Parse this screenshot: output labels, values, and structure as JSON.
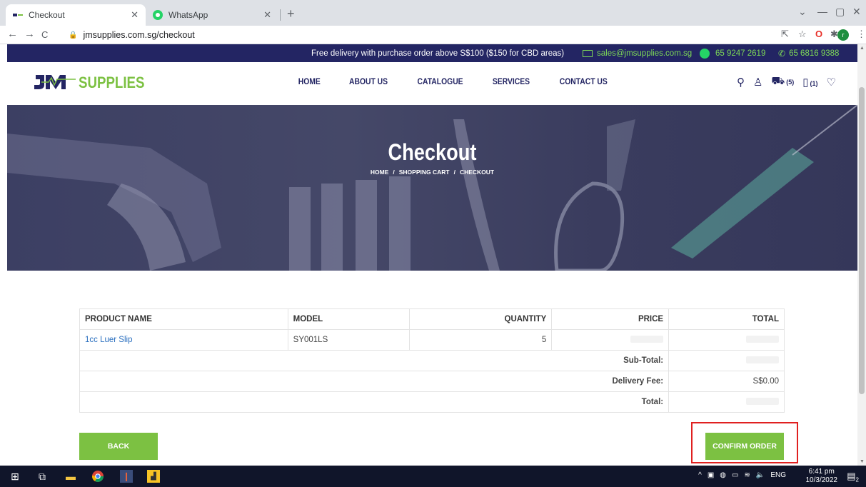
{
  "browser": {
    "tabs": [
      {
        "label": "Checkout",
        "active": true
      },
      {
        "label": "WhatsApp",
        "active": false
      }
    ],
    "url": "jmsupplies.com.sg/checkout",
    "avatar_letter": "r"
  },
  "infobar": {
    "promo": "Free delivery with purchase order above S$100 ($150 for CBD areas)",
    "email": "sales@jmsupplies.com.sg",
    "whatsapp": "65 9247 2619",
    "phone": "65 6816 9388"
  },
  "header": {
    "logo_jm": "JM",
    "logo_supplies": "SUPPLIES",
    "nav": [
      "HOME",
      "ABOUT US",
      "CATALOGUE",
      "SERVICES",
      "CONTACT US"
    ],
    "cart_count": "(5)",
    "quote_count": "(1)"
  },
  "hero": {
    "title": "Checkout",
    "breadcrumb": [
      "HOME",
      "SHOPPING CART",
      "CHECKOUT"
    ]
  },
  "cart": {
    "headers": [
      "PRODUCT NAME",
      "MODEL",
      "QUANTITY",
      "PRICE",
      "TOTAL"
    ],
    "rows": [
      {
        "product": "1cc Luer Slip",
        "model": "SY001LS",
        "quantity": "5"
      }
    ],
    "summary": [
      {
        "label": "Sub-Total:",
        "value": ""
      },
      {
        "label": "Delivery Fee:",
        "value": "S$0.00"
      },
      {
        "label": "Total:",
        "value": ""
      }
    ]
  },
  "actions": {
    "back": "BACK",
    "confirm": "CONFIRM ORDER"
  },
  "taskbar": {
    "time": "6:41 pm",
    "date": "10/3/2022",
    "lang": "ENG",
    "notif_count": "2"
  },
  "colors": {
    "brand_navy": "#232563",
    "brand_green": "#7cc142",
    "highlight": "#e02020"
  }
}
